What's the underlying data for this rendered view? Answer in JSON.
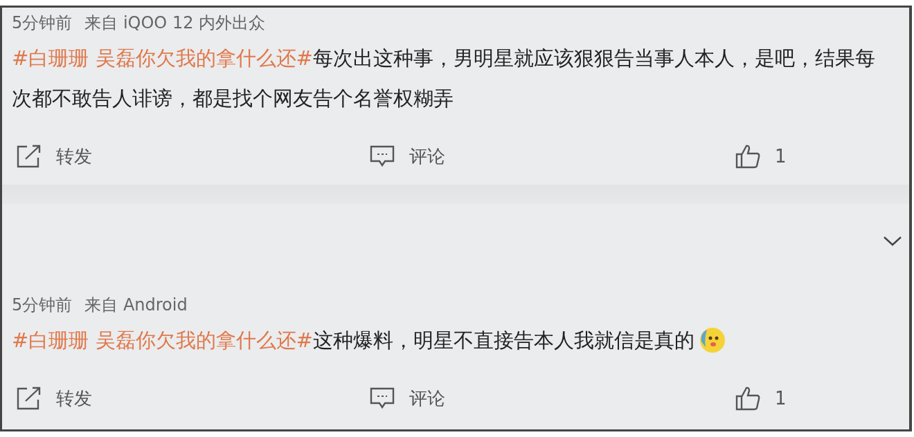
{
  "posts": [
    {
      "time": "5分钟前",
      "source": "来自 iQOO 12 内外出众",
      "topic": "#白珊珊 吴磊你欠我的拿什么还#",
      "text": "每次出这种事，男明星就应该狠狠告当事人本人，是吧，结果每次都不敢告人诽谤，都是找个网友告个名誉权糊弄",
      "emoji": false,
      "repost": "转发",
      "comment": "评论",
      "likes": "1"
    },
    {
      "time": "5分钟前",
      "source": "来自 Android",
      "topic": "#白珊珊 吴磊你欠我的拿什么还#",
      "text": "这种爆料，明星不直接告本人我就信是真的",
      "emoji": true,
      "repost": "转发",
      "comment": "评论",
      "likes": "1"
    }
  ]
}
